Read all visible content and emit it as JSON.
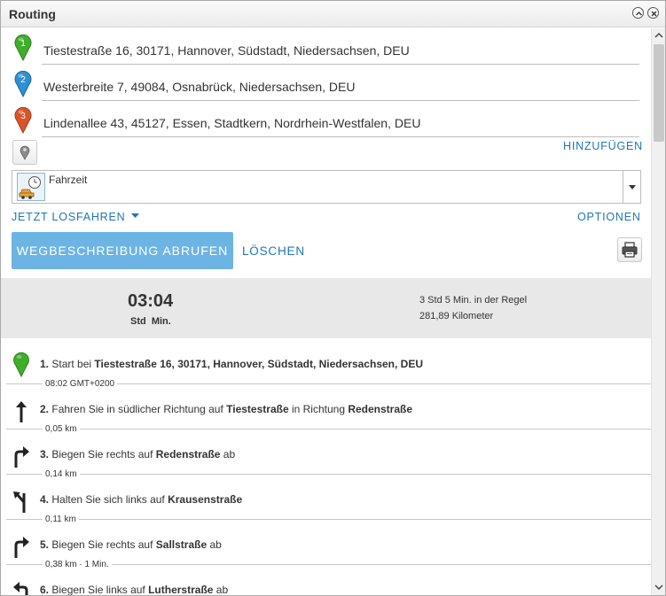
{
  "window": {
    "title": "Routing"
  },
  "waypoints": [
    {
      "number": "1",
      "address": "Tiestestraße 16, 30171, Hannover, Südstadt, Niedersachsen, DEU",
      "color": "#3fae2a"
    },
    {
      "number": "2",
      "address": "Westerbreite 7, 49084, Osnabrück, Niedersachsen, DEU",
      "color": "#2f8fd0"
    },
    {
      "number": "3",
      "address": "Lindenallee 43, 45127, Essen, Stadtkern, Nordrhein-Westfalen, DEU",
      "color": "#d9542c"
    }
  ],
  "actions": {
    "add_label": "HINZUFÜGEN",
    "depart_label": "JETZT LOSFAHREN",
    "options_label": "OPTIONEN",
    "get_directions_label": "WEGBESCHREIBUNG ABRUFEN",
    "clear_label": "LÖSCHEN"
  },
  "route_mode": {
    "label": "Fahrzeit"
  },
  "summary": {
    "time": "03:04",
    "time_units": "Std  Min.",
    "typical": "3 Std 5 Min. in der Regel",
    "distance": "281,89 Kilometer"
  },
  "steps": [
    {
      "number": "1.",
      "icon": "start-pin-icon",
      "parts": [
        [
          "Start bei ",
          false
        ],
        [
          "Tiestestraße 16, 30171, Hannover, Südstadt, Niedersachsen, DEU",
          true
        ]
      ],
      "meta": "08:02 GMT+0200"
    },
    {
      "number": "2.",
      "icon": "arrow-straight-icon",
      "parts": [
        [
          "Fahren Sie in südlicher Richtung auf ",
          false
        ],
        [
          "Tiestestraße",
          true
        ],
        [
          " in Richtung ",
          false
        ],
        [
          "Redenstraße",
          true
        ]
      ],
      "meta": "0,05 km"
    },
    {
      "number": "3.",
      "icon": "turn-right-icon",
      "parts": [
        [
          "Biegen Sie rechts auf ",
          false
        ],
        [
          "Redenstraße",
          true
        ],
        [
          " ab",
          false
        ]
      ],
      "meta": "0,14 km"
    },
    {
      "number": "4.",
      "icon": "keep-left-icon",
      "parts": [
        [
          "Halten Sie sich links auf ",
          false
        ],
        [
          "Krausenstraße",
          true
        ]
      ],
      "meta": "0,11 km"
    },
    {
      "number": "5.",
      "icon": "turn-right-icon",
      "parts": [
        [
          "Biegen Sie rechts auf ",
          false
        ],
        [
          "Sallstraße",
          true
        ],
        [
          " ab",
          false
        ]
      ],
      "meta": "0,38 km · 1 Min."
    },
    {
      "number": "6.",
      "icon": "turn-left-icon",
      "parts": [
        [
          "Biegen Sie links auf ",
          false
        ],
        [
          "Lutherstraße",
          true
        ],
        [
          " ab",
          false
        ]
      ],
      "meta": ""
    }
  ]
}
